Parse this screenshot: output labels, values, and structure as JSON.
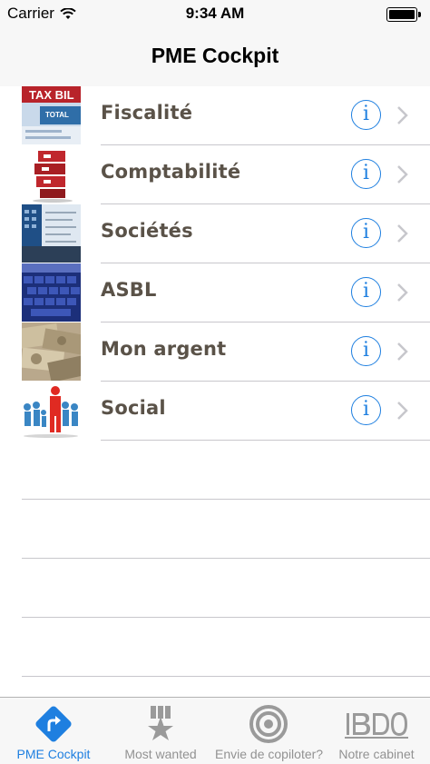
{
  "status_bar": {
    "carrier": "Carrier",
    "time": "9:34 AM"
  },
  "nav": {
    "title": "PME Cockpit"
  },
  "rows": [
    {
      "label": "Fiscalité",
      "thumb_icon": "tax-bill-photo"
    },
    {
      "label": "Comptabilité",
      "thumb_icon": "red-binders-photo"
    },
    {
      "label": "Sociétés",
      "thumb_icon": "calculator-documents-photo"
    },
    {
      "label": "ASBL",
      "thumb_icon": "blue-keyboard-photo"
    },
    {
      "label": "Mon argent",
      "thumb_icon": "banknotes-photo"
    },
    {
      "label": "Social",
      "thumb_icon": "people-figures-photo"
    }
  ],
  "tabs": [
    {
      "label": "PME Cockpit",
      "icon": "directions-arrow-icon",
      "active": true
    },
    {
      "label": "Most wanted",
      "icon": "star-medal-icon",
      "active": false
    },
    {
      "label": "Envie de copiloter?",
      "icon": "target-icon",
      "active": false
    },
    {
      "label": "Notre cabinet",
      "icon": "bdo-logo-icon",
      "active": false
    }
  ],
  "colors": {
    "accent": "#1e7fe0",
    "label": "#5a5248",
    "inactive_tab": "#929292",
    "separator": "#c8c7cc",
    "bar_background": "#f7f7f7"
  }
}
